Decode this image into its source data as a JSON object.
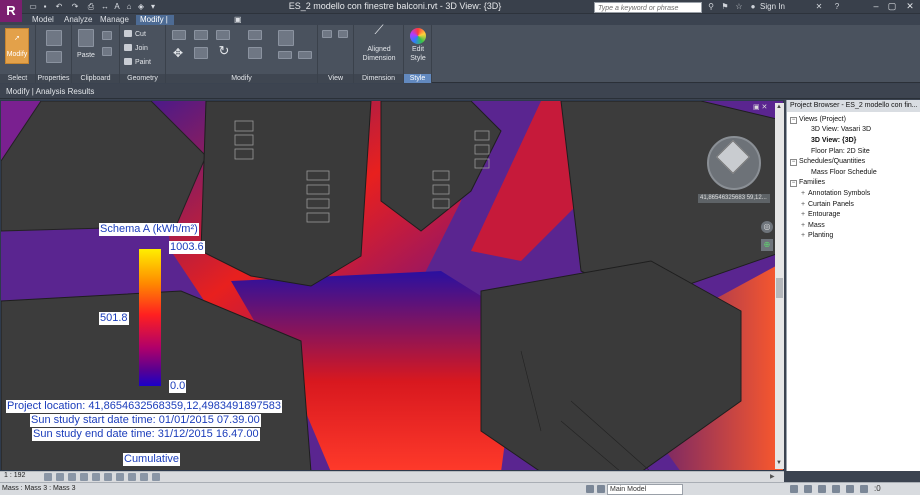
{
  "titlebar": {
    "app_logo": "R",
    "title": "ES_2 modello con finestre balconi.rvt - 3D View: {3D}",
    "search_placeholder": "Type a keyword or phrase",
    "sign_in": "Sign In",
    "quick_access_icons": [
      "open-icon",
      "save-icon",
      "undo-icon",
      "redo-icon",
      "print-icon",
      "measure-icon",
      "text-icon",
      "3d-icon",
      "section-icon",
      "close-hidden-icon",
      "switch-window-icon",
      "dropdown-icon"
    ]
  },
  "tabs": {
    "items": [
      "Model",
      "Analyze",
      "Manage",
      "Modify | Analysis Results"
    ],
    "extra": "▣ ▾",
    "active": "Modify | Analysis Results"
  },
  "ribbon": {
    "modify_label": "Modify",
    "select_label": "Select",
    "properties_label": "Properties",
    "paste_label": "Paste",
    "clipboard_label": "Clipboard",
    "cut_label": "Cut",
    "join_label": "Join",
    "paint_label": "Paint",
    "geometry_label": "Geometry",
    "modify_panel_label": "Modify",
    "view_label": "View",
    "aligned_dimension_label1": "Aligned",
    "aligned_dimension_label2": "Dimension",
    "dimension_label": "Dimension",
    "edit_style_label1": "Edit",
    "edit_style_label2": "Style",
    "style_label": "Style"
  },
  "context_bar": {
    "text": "Modify | Analysis Results"
  },
  "viewport": {
    "legend_title": "Schema A (kWh/m²)",
    "legend_max": "1003.6",
    "legend_mid": "501.8",
    "legend_min": "0.0",
    "project_location": "Project location: 41,8654632568359,12,4983491897583",
    "start_time": "Sun study start date time: 01/01/2015 07.39.00",
    "end_time": "Sun study end date time: 31/12/2015 16.47.00",
    "cumulative": "Cumulative",
    "coord_tooltip": "41,86546325683 59,12...",
    "scale": "1 : 192"
  },
  "project_browser": {
    "title": "Project Browser - ES_2 modello con fin...",
    "items": [
      {
        "label": "Views (Project)",
        "level": 0,
        "expander": "−"
      },
      {
        "label": "3D View: Vasari 3D",
        "level": 1
      },
      {
        "label": "3D View: {3D}",
        "level": 1,
        "selected": true
      },
      {
        "label": "Floor Plan: 2D Site",
        "level": 1
      },
      {
        "label": "Schedules/Quantities",
        "level": 0,
        "expander": "−"
      },
      {
        "label": "Mass Floor Schedule",
        "level": 1
      },
      {
        "label": "Families",
        "level": 0,
        "expander": "−"
      },
      {
        "label": "Annotation Symbols",
        "level": 1,
        "expander": "+"
      },
      {
        "label": "Curtain Panels",
        "level": 1,
        "expander": "+"
      },
      {
        "label": "Entourage",
        "level": 1,
        "expander": "+"
      },
      {
        "label": "Mass",
        "level": 1,
        "expander": "+"
      },
      {
        "label": "Planting",
        "level": 1,
        "expander": "+"
      }
    ]
  },
  "status_bar": {
    "text": "Mass : Mass 3 : Mass 3",
    "model": "Main Model"
  },
  "colors": {
    "accent": "#6289bf",
    "legend_text": "#1b3dbb",
    "heat_hot": "#ff2020",
    "heat_cold": "#1a00c8"
  }
}
